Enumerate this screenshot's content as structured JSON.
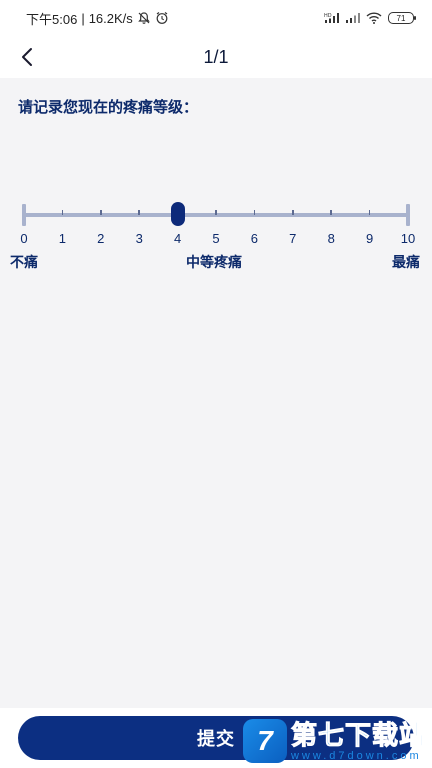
{
  "status_bar": {
    "time": "下午5:06",
    "separator": "|",
    "network_speed": "16.2K/s",
    "battery": "71",
    "icons": [
      "mute-bell-icon",
      "alarm-icon",
      "hd-signal-icon",
      "signal-icon",
      "wifi-icon",
      "battery-icon"
    ]
  },
  "nav": {
    "back_icon": "chevron-left-icon",
    "page_counter": "1/1"
  },
  "question": "请记录您现在的疼痛等级：",
  "scale": {
    "min": 0,
    "max": 10,
    "value": 4,
    "ticks": [
      "0",
      "1",
      "2",
      "3",
      "4",
      "5",
      "6",
      "7",
      "8",
      "9",
      "10"
    ],
    "anchors": {
      "low": "不痛",
      "mid": "中等疼痛",
      "high": "最痛"
    },
    "colors": {
      "track": "#a8b2cd",
      "thumb": "#0d2a7a"
    }
  },
  "submit": {
    "label": "提交",
    "color": "#0c2f82"
  },
  "watermark": {
    "logo_glyph": "7",
    "text": "第七下载站",
    "sub": "www.d7down.com"
  }
}
